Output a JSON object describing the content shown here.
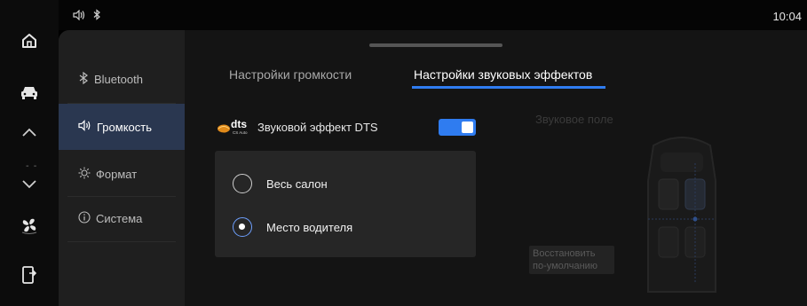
{
  "status": {
    "time": "10:04",
    "icons": [
      "speaker-icon",
      "bluetooth-icon"
    ]
  },
  "rail": {
    "temp_placeholder": "- -",
    "icons": [
      "home-icon",
      "car-icon",
      "chevron-up-icon",
      "chevron-down-icon",
      "fan-icon",
      "phone-mirror-icon"
    ]
  },
  "menu": {
    "items": [
      {
        "label": "Bluetooth",
        "icon": "bluetooth-icon"
      },
      {
        "label": "Громкость",
        "icon": "speaker-icon"
      },
      {
        "label": "Формат",
        "icon": "sun-icon"
      },
      {
        "label": "Система",
        "icon": "info-icon"
      }
    ]
  },
  "tabs": {
    "volume": "Настройки громкости",
    "effects": "Настройки звуковых эффектов"
  },
  "dts": {
    "logo_text": "dts",
    "logo_sub": "CS Auto",
    "label": "Звуковой эффект DTS",
    "enabled": true
  },
  "sound_area": {
    "options": [
      {
        "label": "Весь салон",
        "selected": false
      },
      {
        "label": "Место водителя",
        "selected": true
      }
    ]
  },
  "sound_field": {
    "title": "Звуковое поле",
    "restore_label": "Восстановить по-умолчанию"
  },
  "colors": {
    "accent": "#2f7cf0",
    "menu_active_bg": "#2a3750",
    "dts_logo_orange": "#e08a1a"
  }
}
